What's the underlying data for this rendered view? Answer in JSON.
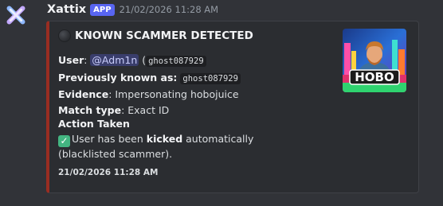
{
  "message": {
    "author": "Xattix",
    "badge": "APP",
    "timestamp": "21/02/2026 11:28 AM"
  },
  "embed": {
    "accent_color": "#992d22",
    "title": "KNOWN SCAMMER DETECTED",
    "title_icon": "black-circle-icon",
    "fields": {
      "user_label": "User",
      "user_mention": "@Adm1n",
      "user_paren_open": " (",
      "user_id": "ghost087929",
      "previously_known_label": "Previously known as",
      "previously_known_value": "ghost087929",
      "evidence_label": "Evidence",
      "evidence_value": "Impersonating hobojuice",
      "match_type_label": "Match type",
      "match_type_value": "Exact ID"
    },
    "action": {
      "title": "Action Taken",
      "icon": "check-mark-icon",
      "text_before": "User has been ",
      "text_bold": "kicked",
      "text_after": " automatically (blacklisted scammer)."
    },
    "footer": "21/02/2026 11:28 AM",
    "thumbnail": {
      "logo_text": "HOBO"
    }
  }
}
